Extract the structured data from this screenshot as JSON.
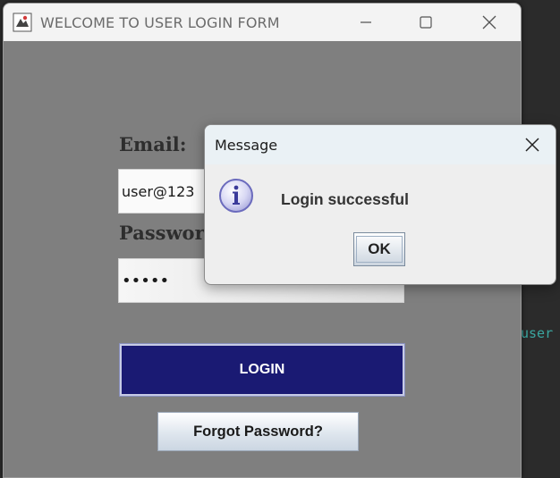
{
  "background": {
    "code_fragments": [
      "user"
    ]
  },
  "main_window": {
    "title": "WELCOME TO USER LOGIN FORM",
    "email_label": "Email:",
    "email_value": "user@123",
    "password_label": "Password:",
    "password_value": "•••••",
    "login_label": "LOGIN",
    "forgot_label": "Forgot Password?",
    "colors": {
      "background": "#7f7f7f",
      "login_button": "#1a1a73"
    }
  },
  "dialog": {
    "title": "Message",
    "message": "Login successful",
    "ok_label": "OK",
    "icon": "info-icon"
  }
}
